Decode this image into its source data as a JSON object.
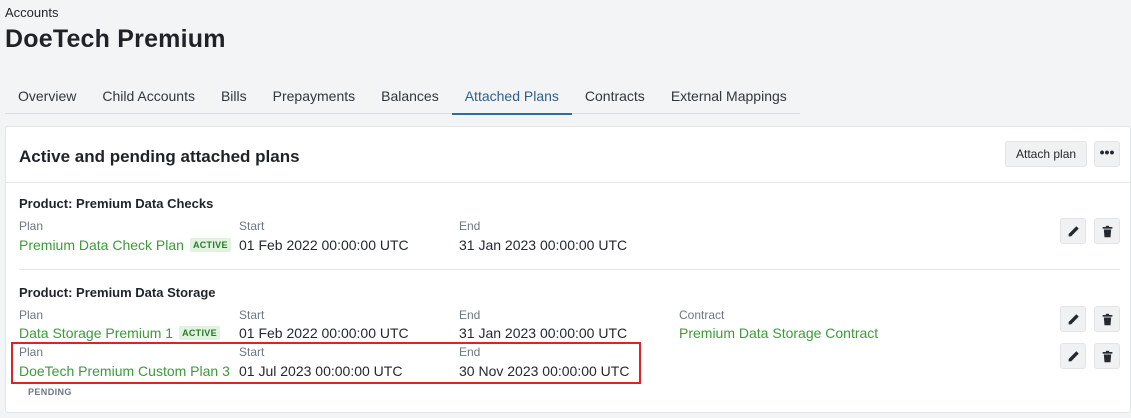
{
  "header": {
    "breadcrumb": "Accounts",
    "title": "DoeTech Premium"
  },
  "tabs": [
    {
      "label": "Overview"
    },
    {
      "label": "Child Accounts"
    },
    {
      "label": "Bills"
    },
    {
      "label": "Prepayments"
    },
    {
      "label": "Balances"
    },
    {
      "label": "Attached Plans",
      "active": true
    },
    {
      "label": "Contracts"
    },
    {
      "label": "External Mappings"
    }
  ],
  "card": {
    "title": "Active and pending attached plans",
    "attach_label": "Attach plan",
    "more_label": "•••"
  },
  "labels": {
    "plan": "Plan",
    "start": "Start",
    "end": "End",
    "contract": "Contract"
  },
  "products": [
    {
      "title": "Product: Premium Data Checks",
      "plans": [
        {
          "name": "Premium Data Check Plan",
          "status": "ACTIVE",
          "start": "01 Feb 2022 00:00:00 UTC",
          "end": "31 Jan 2023 00:00:00 UTC"
        }
      ]
    },
    {
      "title": "Product: Premium Data Storage",
      "plans": [
        {
          "name": "Data Storage Premium 1",
          "status": "ACTIVE",
          "start": "01 Feb 2022 00:00:00 UTC",
          "end": "31 Jan 2023 00:00:00 UTC",
          "contract": "Premium Data Storage Contract"
        },
        {
          "name": "DoeTech Premium Custom Plan 3",
          "status": "PENDING",
          "start": "01 Jul 2023 00:00:00 UTC",
          "end": "30 Nov 2023 00:00:00 UTC"
        }
      ]
    }
  ],
  "icons": {
    "edit": "pencil-icon",
    "delete": "trash-icon"
  },
  "colors": {
    "link": "#3c9a3c",
    "active_tab": "#2e6e9e",
    "highlight": "#d9252a"
  }
}
